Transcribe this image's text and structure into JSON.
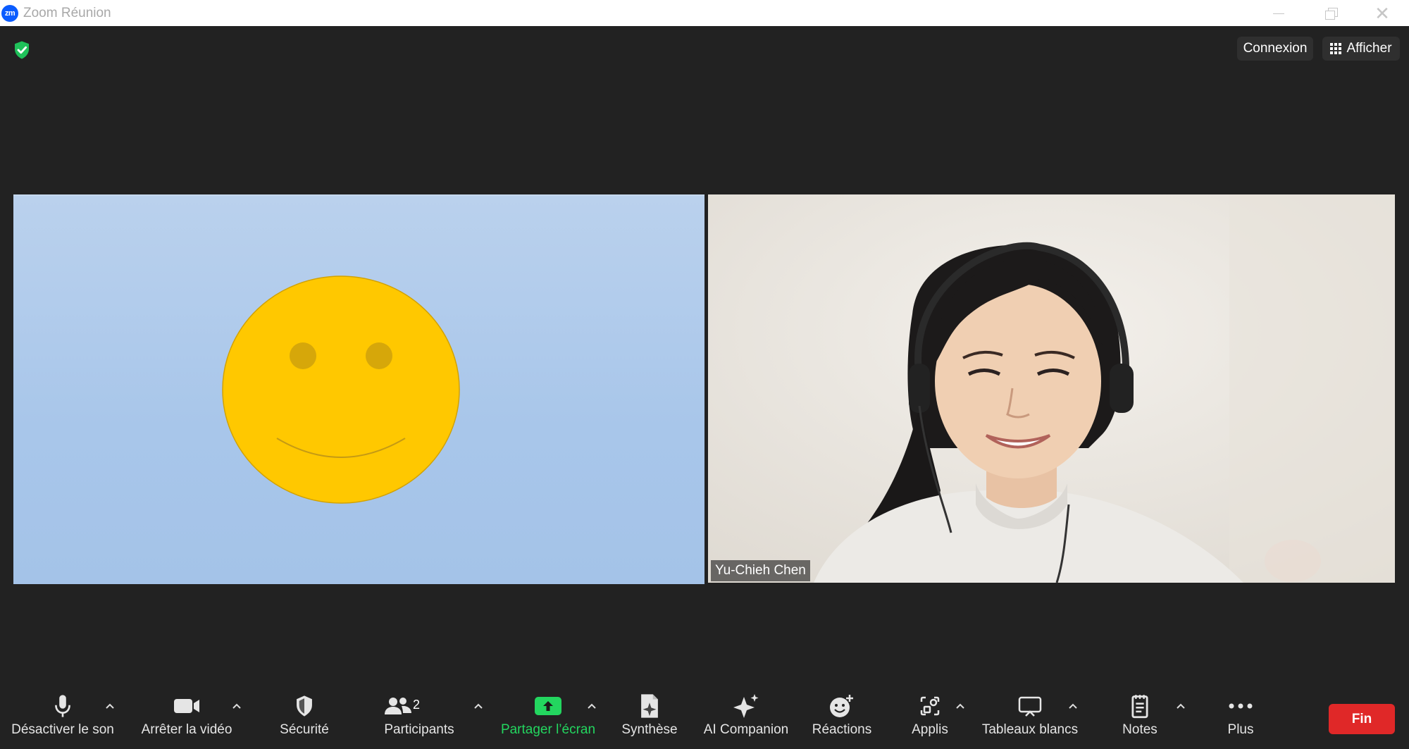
{
  "window": {
    "app_badge": "zm",
    "title": "Zoom Réunion"
  },
  "top_bar": {
    "connexion_label": "Connexion",
    "afficher_label": "Afficher"
  },
  "tiles": [
    {
      "participant": "",
      "content": "smiley-face-avatar"
    },
    {
      "participant": "Yu-Chieh Chen",
      "content": "camera-video"
    }
  ],
  "toolbar": {
    "mute_label": "Désactiver le son",
    "video_label": "Arrêter la vidéo",
    "security_label": "Sécurité",
    "participants_label": "Participants",
    "participants_count": "2",
    "share_label": "Partager l’écran",
    "summary_label": "Synthèse",
    "ai_label": "AI Companion",
    "reactions_label": "Réactions",
    "apps_label": "Applis",
    "whiteboards_label": "Tableaux blancs",
    "notes_label": "Notes",
    "more_label": "Plus",
    "end_label": "Fin"
  },
  "colors": {
    "background": "#222222",
    "share_green": "#23d65f",
    "end_red": "#e02828",
    "shield_green": "#1fc15a",
    "zoom_blue": "#0b5cff"
  }
}
